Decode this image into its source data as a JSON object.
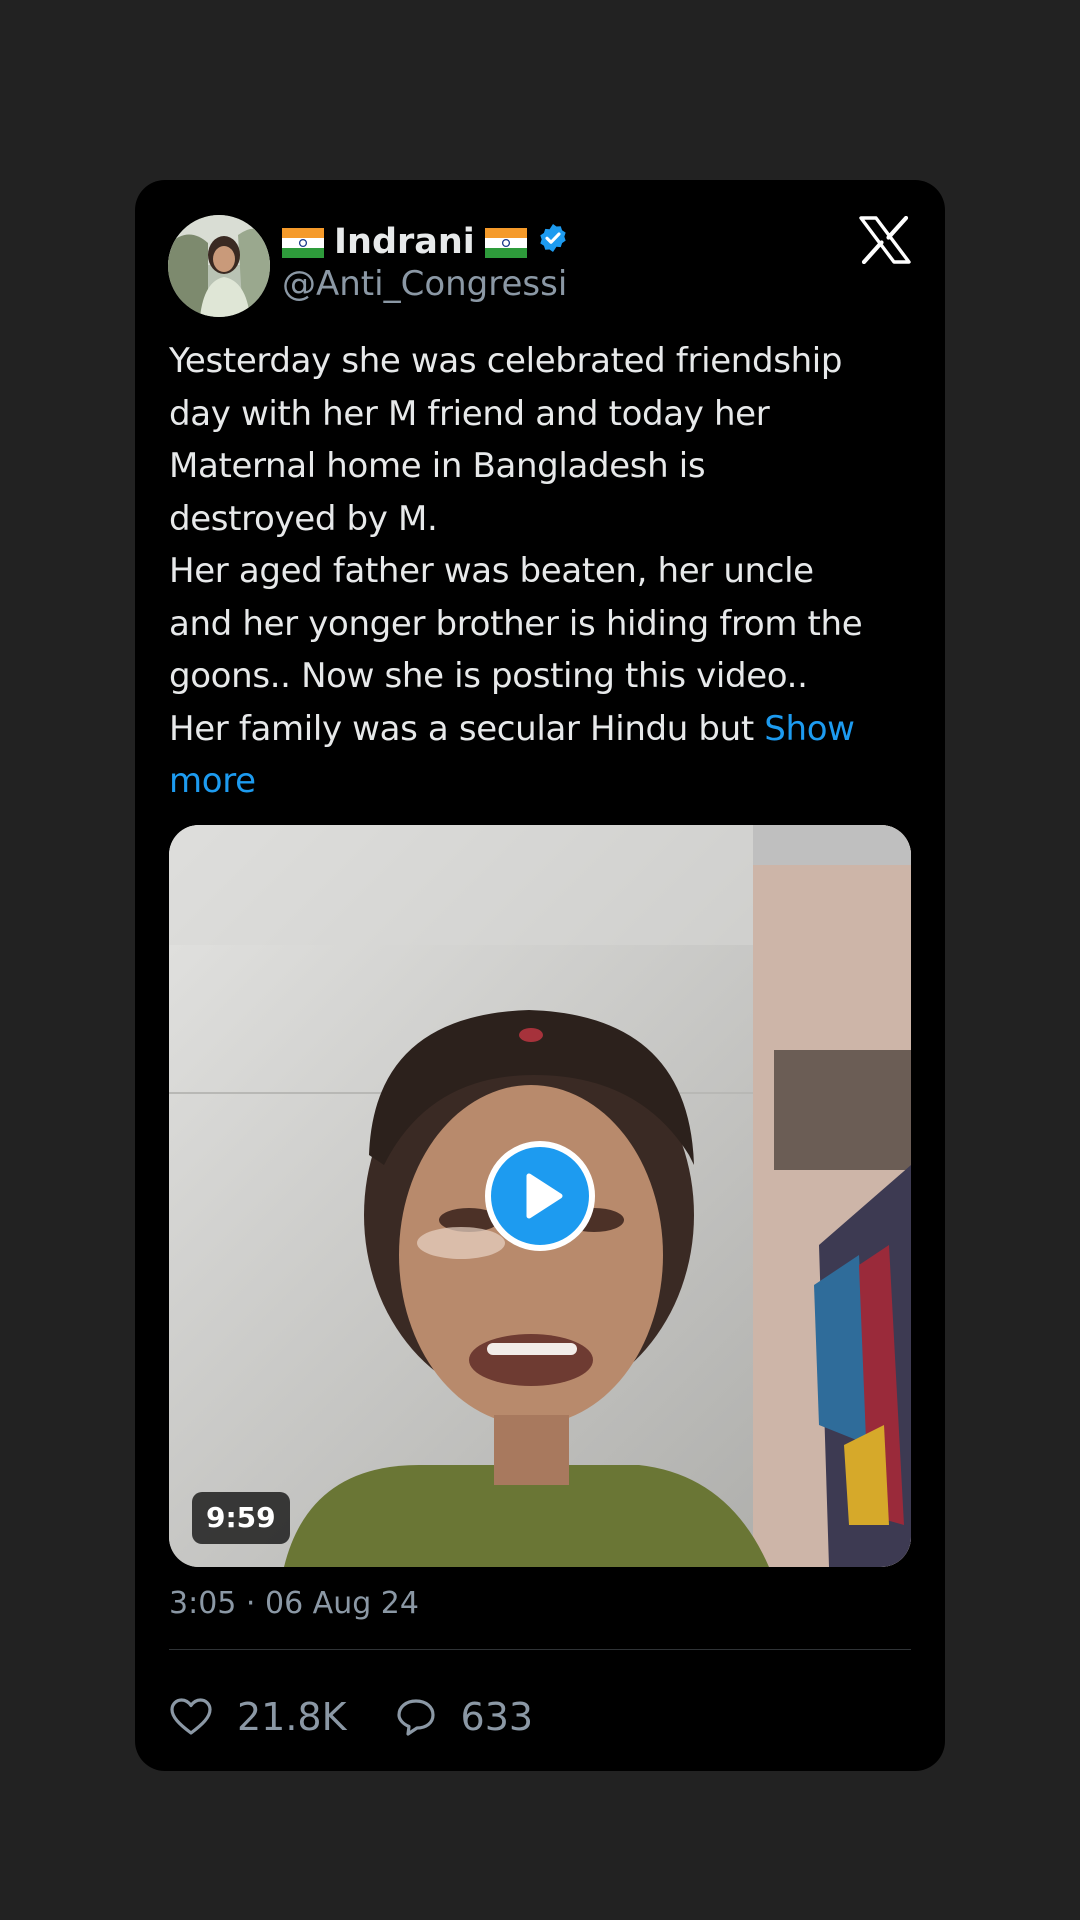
{
  "author": {
    "display_name": "Indrani",
    "handle": "@Anti_Congressi",
    "verified": true,
    "flags": [
      "india-flag-icon",
      "india-flag-icon"
    ]
  },
  "tweet": {
    "text": "Yesterday she was celebrated friendship\nday with her M friend and today her\nMaternal home in Bangladesh is\ndestroyed by M.\nHer aged father was beaten, her uncle\nand her yonger brother is hiding from the\ngoons.. Now she is posting this video..\nHer family was a secular Hindu but ",
    "show_more": "Show\nmore"
  },
  "video": {
    "duration": "9:59",
    "play_icon": "play-icon"
  },
  "timestamp": "3:05 · 06 Aug 24",
  "stats": {
    "likes": "21.8K",
    "replies": "633"
  },
  "colors": {
    "background": "#222222",
    "card": "#000000",
    "accent": "#1d9bf0",
    "text": "#e7e9ea",
    "muted": "#8b98a5"
  }
}
